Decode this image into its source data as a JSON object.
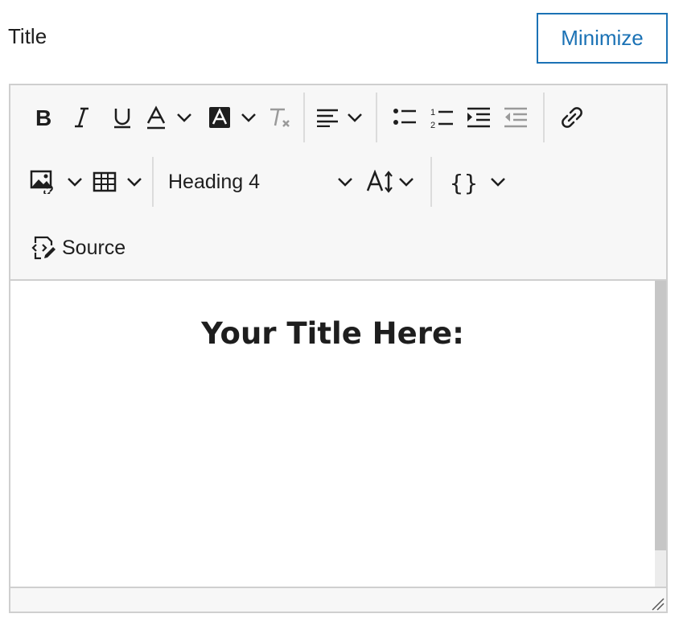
{
  "field": {
    "label": "Title"
  },
  "minimize_button": {
    "label": "Minimize"
  },
  "toolbar": {
    "row1": [
      {
        "name": "bold",
        "icon": "bold-icon"
      },
      {
        "name": "italic",
        "icon": "italic-icon"
      },
      {
        "name": "underline",
        "icon": "underline-icon"
      },
      {
        "name": "font-color",
        "icon": "font-color-icon",
        "dropdown": true
      },
      {
        "name": "background-color",
        "icon": "background-color-icon",
        "dropdown": true
      },
      {
        "name": "remove-format",
        "icon": "remove-format-icon",
        "disabled": true
      },
      {
        "name": "alignment",
        "icon": "align-left-icon",
        "dropdown": true
      },
      {
        "name": "bulleted-list",
        "icon": "bulleted-list-icon"
      },
      {
        "name": "numbered-list",
        "icon": "numbered-list-icon"
      },
      {
        "name": "indent",
        "icon": "indent-icon"
      },
      {
        "name": "outdent",
        "icon": "outdent-icon",
        "disabled": true
      },
      {
        "name": "link",
        "icon": "link-icon"
      }
    ],
    "row2": {
      "insert_image_icon": "image-link-icon",
      "insert_table_icon": "table-icon",
      "heading_select": {
        "value": "Heading 4"
      },
      "font_size_icon": "font-size-icon",
      "code_icon": "code-braces-icon"
    },
    "source_button": {
      "label": "Source",
      "icon": "source-edit-icon"
    }
  },
  "content": {
    "heading_text": "Your Title Here:"
  },
  "colors": {
    "accent": "#1b72b5",
    "text": "#1e1e1e",
    "border": "#cfcfcf",
    "toolbar_bg": "#f7f7f7",
    "disabled": "#9a9a9a"
  }
}
